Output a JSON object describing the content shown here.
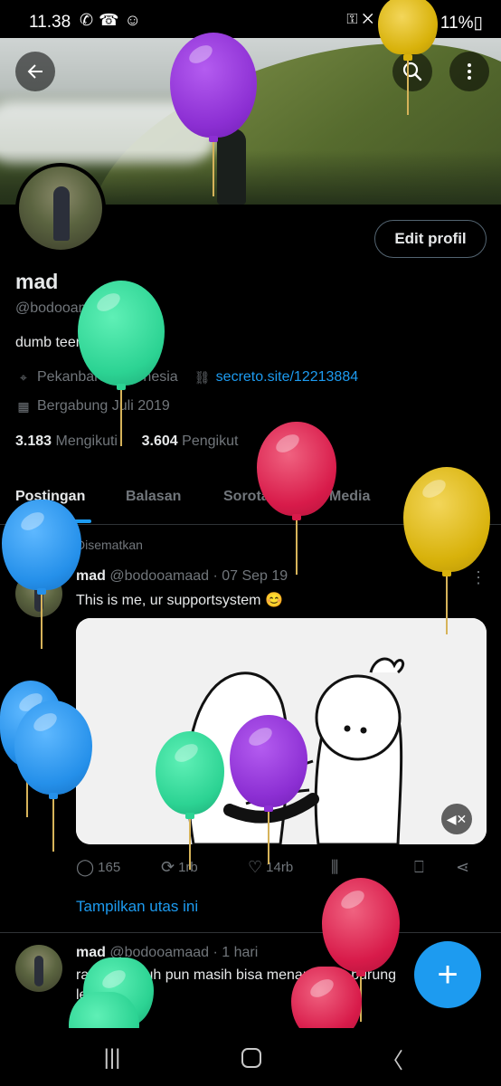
{
  "status_bar": {
    "time": "11.38",
    "left_icons": [
      "phone-wifi-call-icon",
      "missed-call-icon",
      "bot-icon"
    ],
    "right_icons": [
      "key-icon",
      "mute-icon",
      "signal-icon",
      "4g-icon",
      "signal-icon"
    ],
    "battery": "11%"
  },
  "header": {
    "back_icon": "←",
    "search_icon": "⌕",
    "more_icon": "⋮"
  },
  "profile": {
    "edit_button": "Edit profil",
    "name": "mad",
    "handle": "@bodooamaad",
    "bio": "dumb teen boi.",
    "location": "Pekanbaru, Indonesia",
    "website": "secreto.site/12213884",
    "joined": "Bergabung Juli 2019",
    "following_count": "3.183",
    "following_label": "Mengikuti",
    "followers_count": "3.604",
    "followers_label": "Pengikut"
  },
  "tabs": [
    {
      "label": "Postingan"
    },
    {
      "label": "Balasan"
    },
    {
      "label": "Sorotan"
    },
    {
      "label": "Media"
    },
    {
      "label": "Suka"
    }
  ],
  "pinned_post": {
    "pinned_label": "Disematkan",
    "name": "mad",
    "handle": "@bodooamaad",
    "date": "· 07 Sep 19",
    "text": "This is me, ur supportsystem 😊",
    "replies": "165",
    "reposts": "1rb",
    "likes": "14rb",
    "show_thread": "Tampilkan utas ini"
  },
  "second_post": {
    "name": "mad",
    "handle": "@bodooamaad",
    "date": "· 1 hari",
    "text_line1": "ranting rapuh pun masih bisa menampung burung",
    "text_line2": "lelah"
  },
  "fab_label": "+",
  "colors": {
    "accent": "#1d9bf0",
    "background": "#000000",
    "text_primary": "#e7e9ea",
    "text_secondary": "#71767b",
    "balloon_purple": "#8c2fd3",
    "balloon_green": "#2cd393",
    "balloon_red": "#d81b4a",
    "balloon_gold": "#d8b20b",
    "balloon_blue": "#2590ea"
  }
}
